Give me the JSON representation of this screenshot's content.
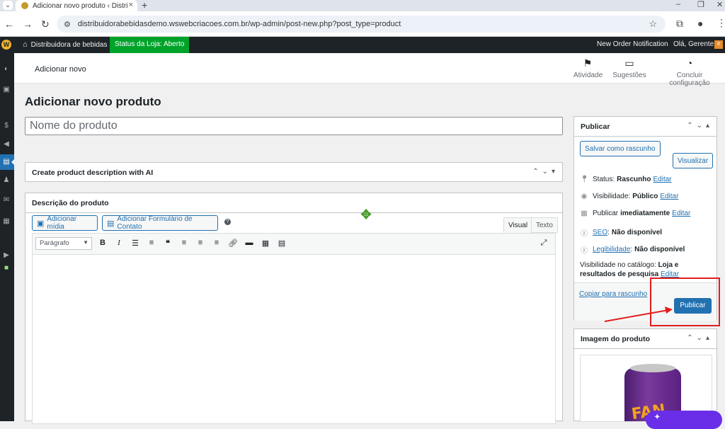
{
  "browser": {
    "tab_title": "Adicionar novo produto ‹ Distri",
    "new_tab": "+",
    "url": "distribuidorabebidasdemo.wswebcriacoes.com.br/wp-admin/post-new.php?post_type=product"
  },
  "adminbar": {
    "site_name": "Distribuidora de bebidas",
    "store_status": "Status da Loja: Aberto",
    "notification": "New Order Notification",
    "greeting": "Olá, Gerente"
  },
  "wc_header": {
    "title": "Adicionar novo",
    "actions": [
      {
        "label": "Atividade",
        "icon": "flag-icon"
      },
      {
        "label": "Sugestões",
        "icon": "message-icon"
      },
      {
        "label": "Concluir configuração",
        "icon": "progress-icon"
      }
    ]
  },
  "page": {
    "heading": "Adicionar novo produto",
    "title_placeholder": "Nome do produto"
  },
  "ai_box": {
    "title": "Create product description with AI"
  },
  "description": {
    "title": "Descrição do produto",
    "add_media": "Adicionar mídia",
    "add_form": "Adicionar Formulário de Contato",
    "tab_visual": "Visual",
    "tab_text": "Texto",
    "format_select": "Parágrafo"
  },
  "publish": {
    "title": "Publicar",
    "save_draft": "Salvar como rascunho",
    "preview": "Visualizar",
    "status_label": "Status:",
    "status_value": "Rascunho",
    "visibility_label": "Visibilidade:",
    "visibility_value": "Público",
    "publish_label": "Publicar",
    "publish_value": "imediatamente",
    "seo_label": "SEO",
    "seo_value": "Não disponível",
    "legibility_label": "Legibilidade",
    "legibility_value": "Não disponível",
    "catalog_label": "Visibilidade no catálogo:",
    "catalog_value": "Loja e resultados de pesquisa",
    "edit": "Editar",
    "copy_draft": "Copiar para rascunho",
    "publish_button": "Publicar"
  },
  "product_image": {
    "title": "Imagem do produto"
  },
  "colors": {
    "admin_bar": "#1d2327",
    "accent": "#2271b1",
    "store_open": "#00a32a",
    "annotation": "#e01e1e"
  }
}
